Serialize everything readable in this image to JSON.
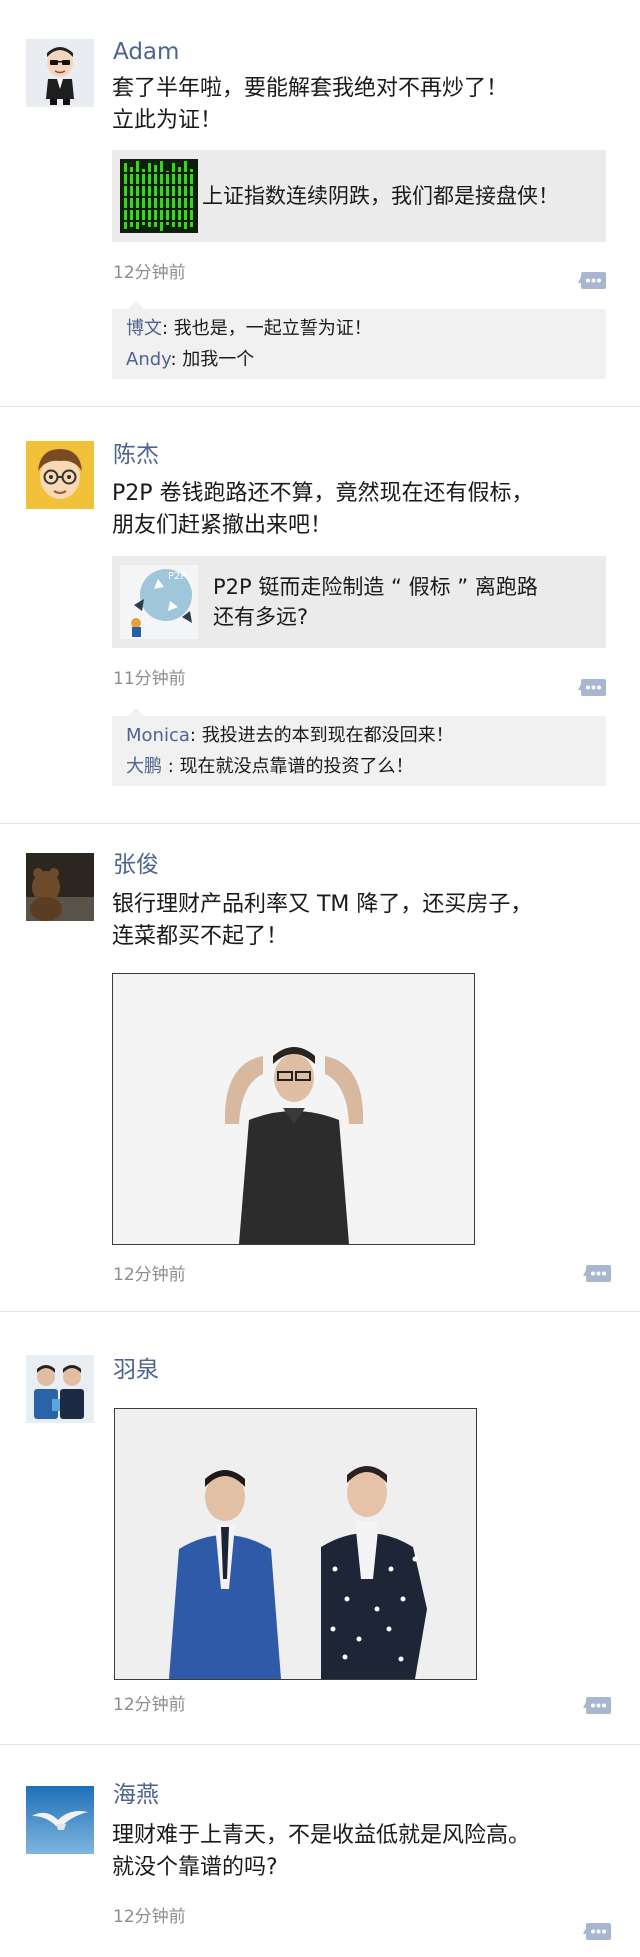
{
  "posts": [
    {
      "name": "Adam",
      "text": "套了半年啦，要能解套我绝对不再炒了！\n立此为证！",
      "link": {
        "title": "上证指数连续阴跌，我们都是接盘侠！"
      },
      "time": "12分钟前",
      "comments": [
        {
          "author": "博文",
          "sep": ": ",
          "text": "我也是，一起立誓为证！"
        },
        {
          "author": "Andy",
          "sep": ": ",
          "text": "加我一个"
        }
      ]
    },
    {
      "name": "陈杰",
      "text": "P2P 卷钱跑路还不算，竟然现在还有假标，\n朋友们赶紧撤出来吧！",
      "link": {
        "title": "P2P 铤而走险制造 “ 假标 ” 离跑路\n还有多远?",
        "thumb_label": "P2P"
      },
      "time": "11分钟前",
      "comments": [
        {
          "author": "Monica",
          "sep": ": ",
          "text": "我投进去的本到现在都没回来！"
        },
        {
          "author": "大鹏",
          "sep": " : ",
          "text": "现在就没点靠谱的投资了么！"
        }
      ]
    },
    {
      "name": "张俊",
      "text": "银行理财产品利率又 TM 降了，还买房子，\n连菜都买不起了！",
      "time": "12分钟前"
    },
    {
      "name": "羽泉",
      "time": "12分钟前"
    },
    {
      "name": "海燕",
      "text": "理财难于上青天，不是收益低就是风险高。\n就没个靠谱的吗?",
      "time": "12分钟前"
    }
  ],
  "colors": {
    "name": "#4f6391",
    "time": "#8d8d8d",
    "card_bg": "#ebebeb",
    "comment_bg": "#f1f1f1"
  },
  "icons": {
    "comment_button": "comment-bubble-icon"
  }
}
